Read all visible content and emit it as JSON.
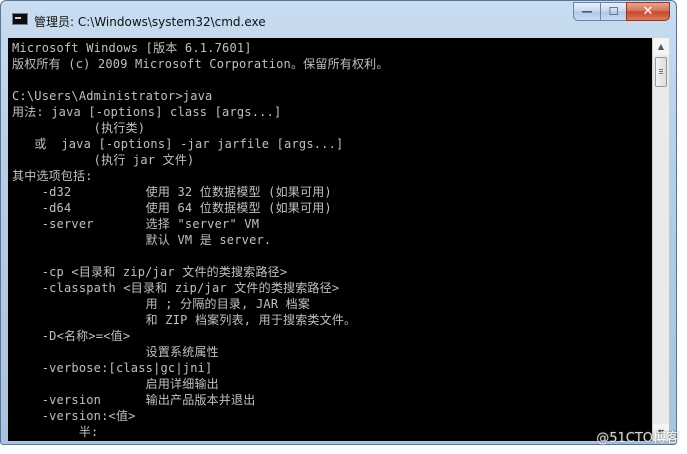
{
  "window": {
    "title": "管理员: C:\\Windows\\system32\\cmd.exe",
    "app_icon": "cmd-console-icon",
    "buttons": {
      "minimize": "—",
      "maximize": "☐",
      "close": "✕"
    }
  },
  "console": {
    "text_color": "#c0c0c0",
    "background": "#000000",
    "lines": [
      "Microsoft Windows [版本 6.1.7601]",
      "版权所有 (c) 2009 Microsoft Corporation。保留所有权利。",
      "",
      "C:\\Users\\Administrator>java",
      "用法: java [-options] class [args...]",
      "           (执行类)",
      "   或  java [-options] -jar jarfile [args...]",
      "           (执行 jar 文件)",
      "其中选项包括:",
      "    -d32          使用 32 位数据模型 (如果可用)",
      "    -d64          使用 64 位数据模型 (如果可用)",
      "    -server       选择 \"server\" VM",
      "                  默认 VM 是 server.",
      "",
      "    -cp <目录和 zip/jar 文件的类搜索路径>",
      "    -classpath <目录和 zip/jar 文件的类搜索路径>",
      "                  用 ; 分隔的目录, JAR 档案",
      "                  和 ZIP 档案列表, 用于搜索类文件。",
      "    -D<名称>=<值>",
      "                  设置系统属性",
      "    -verbose:[class|gc|jni]",
      "                  启用详细输出",
      "    -version      输出产品版本并退出",
      "    -version:<值>",
      "         半:"
    ]
  },
  "scrollbar": {
    "up_arrow": "▲",
    "down_arrow": "▼"
  },
  "watermark": "@51CTO博客"
}
